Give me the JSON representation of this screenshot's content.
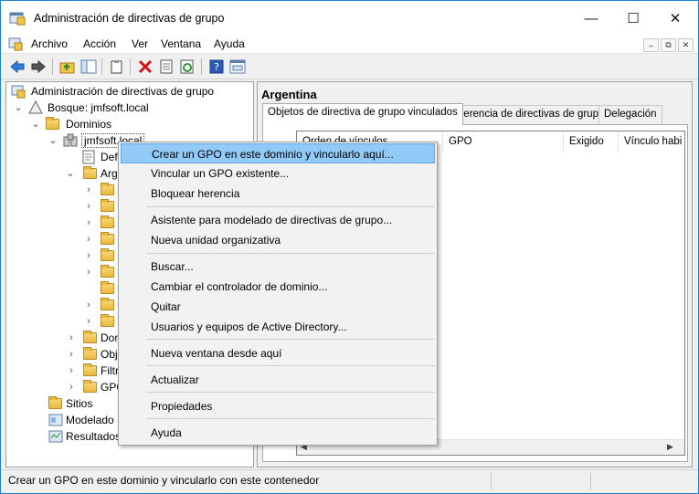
{
  "window": {
    "title": "Administración de directivas de grupo",
    "minimize": "—",
    "maximize": "☐",
    "close": "✕"
  },
  "menubar": {
    "items": [
      "Archivo",
      "Acción",
      "Ver",
      "Ventana",
      "Ayuda"
    ],
    "mdi_min": "–",
    "mdi_restore": "⧉",
    "mdi_close": "✕"
  },
  "tree": {
    "root": "Administración de directivas de grupo",
    "forest": "Bosque: jmfsoft.local",
    "domains": "Dominios",
    "domain": "jmfsoft.local",
    "default_policy": "Def",
    "ou_argentina": "Arg",
    "dom_controllers": "Dom",
    "gpo_objects": "Obj",
    "wmi_filters": "Filtr",
    "starter_gpos": "GPO",
    "sites": "Sitios",
    "modeling": "Modelado",
    "results": "Resultados"
  },
  "right_pane": {
    "title": "Argentina",
    "tabs": [
      "Objetos de directiva de grupo vinculados",
      "Herencia de directivas de grupo",
      "Delegación"
    ],
    "columns": [
      "Orden de vínculos",
      "GPO",
      "Exigido",
      "Vínculo habi"
    ]
  },
  "context_menu": {
    "items": [
      "Crear un GPO en este dominio y vincularlo aquí...",
      "Vincular un GPO existente...",
      "Bloquear herencia",
      "Asistente para modelado de directivas de grupo...",
      "Nueva unidad organizativa",
      "Buscar...",
      "Cambiar el controlador de dominio...",
      "Quitar",
      "Usuarios y equipos de Active Directory...",
      "Nueva ventana desde aquí",
      "Actualizar",
      "Propiedades",
      "Ayuda"
    ]
  },
  "status": {
    "text": "Crear un GPO en este dominio y vincularlo con este contenedor"
  },
  "colors": {
    "window_border": "#1883d7",
    "menu_highlight": "#91c9f7",
    "folder": "#e8b93d"
  }
}
